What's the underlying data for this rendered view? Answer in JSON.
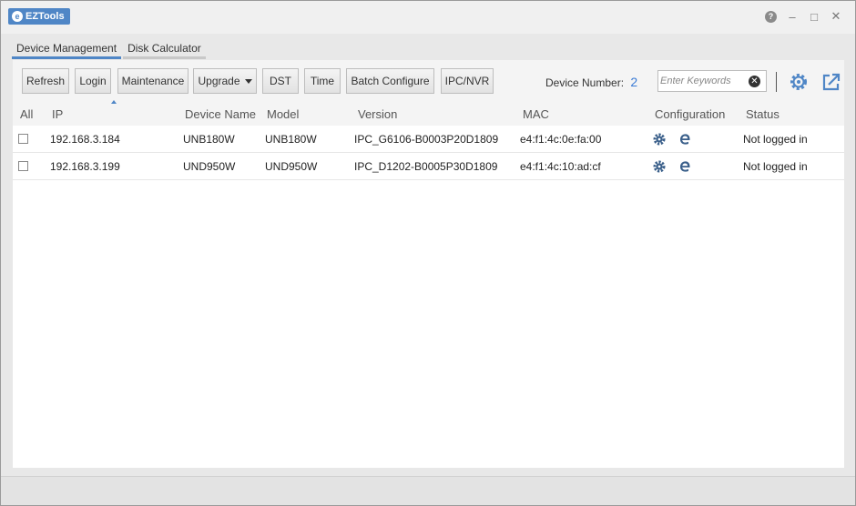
{
  "app": {
    "title": "EZTools"
  },
  "tabs": [
    {
      "label": "Device Management",
      "active": true
    },
    {
      "label": "Disk Calculator",
      "active": false
    }
  ],
  "toolbar": {
    "refresh": "Refresh",
    "login": "Login",
    "maintenance": "Maintenance",
    "upgrade": "Upgrade",
    "dst": "DST",
    "time": "Time",
    "batch_configure": "Batch Configure",
    "ipc_nvr": "IPC/NVR",
    "device_number_label": "Device Number:",
    "device_number_value": "2",
    "search_placeholder": "Enter Keywords"
  },
  "table": {
    "columns": {
      "all": "All",
      "ip": "IP",
      "device_name": "Device Name",
      "model": "Model",
      "version": "Version",
      "mac": "MAC",
      "configuration": "Configuration",
      "status": "Status"
    },
    "rows": [
      {
        "ip": "192.168.3.184",
        "device_name": "UNB180W",
        "model": "UNB180W",
        "version": "IPC_G6106-B0003P20D1809",
        "mac": "e4:f1:4c:0e:fa:00",
        "status": "Not logged in"
      },
      {
        "ip": "192.168.3.199",
        "device_name": "UND950W",
        "model": "UND950W",
        "version": "IPC_D1202-B0005P30D1809",
        "mac": "e4:f1:4c:10:ad:cf",
        "status": "Not logged in"
      }
    ]
  },
  "colors": {
    "accent": "#4f86c6",
    "device_number": "#3a7bd5"
  },
  "icons": [
    "help-icon",
    "minimize-icon",
    "maximize-icon",
    "close-icon",
    "settings-gear-icon",
    "export-icon",
    "clear-search-icon",
    "config-gear-icon",
    "browser-e-icon"
  ]
}
